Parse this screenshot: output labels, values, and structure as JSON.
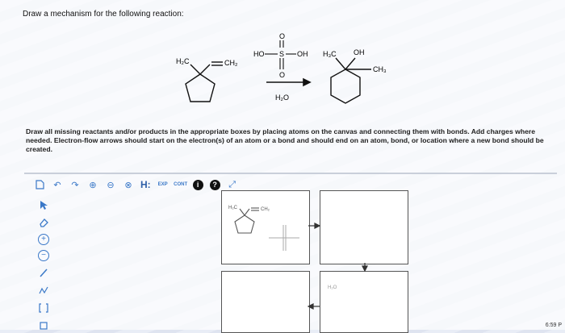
{
  "question": {
    "prompt": "Draw a mechanism for the following reaction:"
  },
  "reaction": {
    "reactant_labels": [
      "H₂C",
      "CH₂"
    ],
    "reagent_labels": [
      "O",
      "HO",
      "S",
      "OH",
      "O"
    ],
    "condition": "H₂O",
    "product_labels": [
      "H₃C",
      "OH",
      "CH₃"
    ]
  },
  "instructions": {
    "text": "Draw all missing reactants and/or products in the appropriate boxes by placing atoms on the canvas and connecting them with bonds. Add charges where needed. Electron-flow arrows should start on the electron(s) of an atom or a bond and should end on an atom, bond, or location where a new bond should be created."
  },
  "toolbar": {
    "hint_label": "H:",
    "exp_label": "EXP",
    "cont_label": "CONT",
    "info_label": "i",
    "help_label": "?"
  },
  "sidebar": {
    "plus_label": "+",
    "minus_label": "−"
  },
  "canvas": {
    "box1_labels": [
      "H₂C",
      "CH₂"
    ],
    "box4_hint": "H₂O"
  },
  "status": {
    "clock": "6:59 P"
  }
}
